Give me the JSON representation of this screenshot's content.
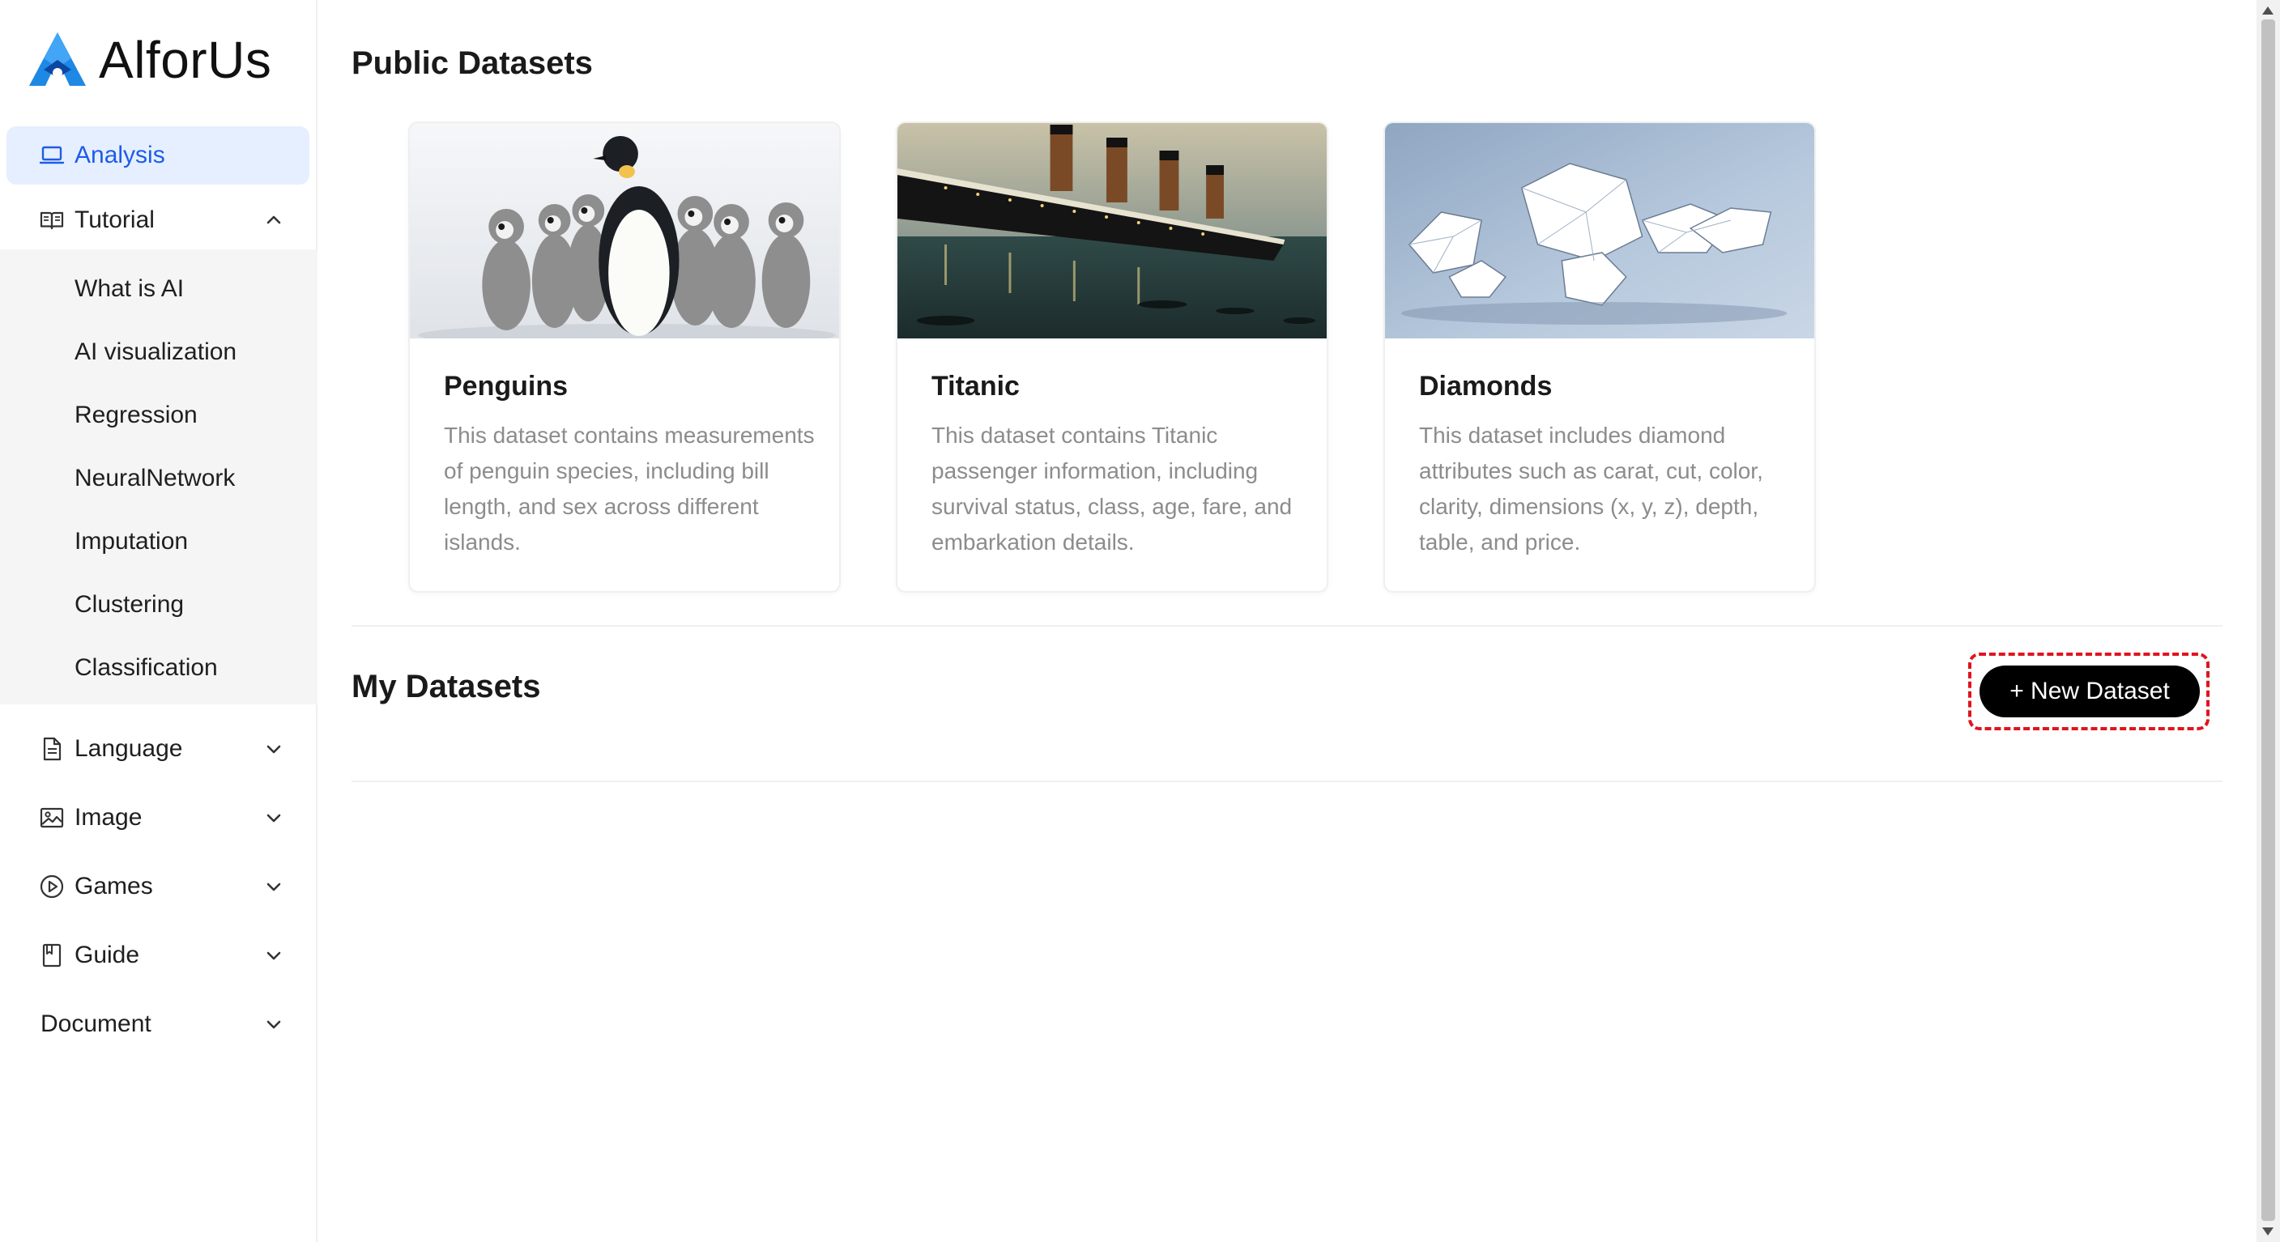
{
  "app": {
    "name": "AlforUs",
    "brand_color": "#1e88e5"
  },
  "sidebar": {
    "items": [
      {
        "label": "Analysis",
        "icon": "laptop-icon",
        "active": true
      },
      {
        "label": "Tutorial",
        "icon": "book-open-icon",
        "expanded": true,
        "children": [
          "What is AI",
          "AI visualization",
          "Regression",
          "NeuralNetwork",
          "Imputation",
          "Clustering",
          "Classification"
        ]
      },
      {
        "label": "Language",
        "icon": "document-icon",
        "expanded": false
      },
      {
        "label": "Image",
        "icon": "picture-icon",
        "expanded": false
      },
      {
        "label": "Games",
        "icon": "play-circle-icon",
        "expanded": false
      },
      {
        "label": "Guide",
        "icon": "bookmark-book-icon",
        "expanded": false
      },
      {
        "label": "Document",
        "icon": "",
        "expanded": false
      }
    ]
  },
  "main": {
    "public_title": "Public Datasets",
    "datasets": [
      {
        "title": "Penguins",
        "description": "This dataset contains measurements of penguin species, including bill length, and sex across different islands.",
        "image": "penguins-photo"
      },
      {
        "title": "Titanic",
        "description": "This dataset contains Titanic passenger information, including survival status, class, age, fare, and embarkation details.",
        "image": "titanic-painting"
      },
      {
        "title": "Diamonds",
        "description": "This dataset includes diamond attributes such as carat, cut, color, clarity, dimensions (x, y, z), depth, table, and price.",
        "image": "diamonds-photo"
      }
    ],
    "my_title": "My Datasets",
    "new_button_label": "+ New Dataset"
  },
  "colors": {
    "active_bg": "#e6efff",
    "active_text": "#1e5ce8",
    "highlight_outline": "#e0141e",
    "button_bg": "#000000"
  }
}
